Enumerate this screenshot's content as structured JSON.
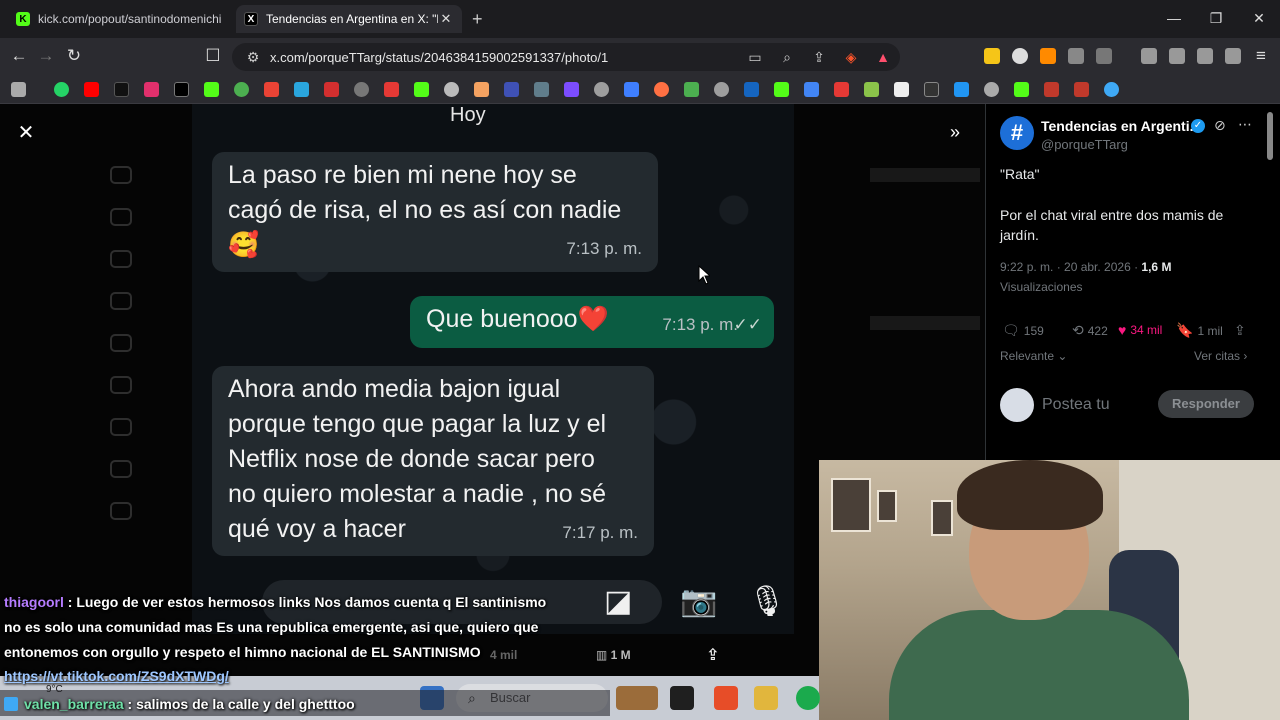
{
  "browser": {
    "tabs": [
      {
        "title": "kick.com/popout/santinodomenichi",
        "active": false
      },
      {
        "title": "Tendencias en Argentina en X: \"R",
        "active": true
      }
    ],
    "url": "x.com/porqueTTarg/status/2046384159002591337/photo/1"
  },
  "chat_photo": {
    "day_label": "Hoy",
    "messages": [
      {
        "direction": "in",
        "text_lines": [
          "La paso re bien mi nene hoy se",
          "cagó de risa, el no es así con nadie",
          "🥰"
        ],
        "time": "7:13 p. m."
      },
      {
        "direction": "out",
        "text": "Que buenooo❤️",
        "time": "7:13 p. m.",
        "ticks": "✓✓"
      },
      {
        "direction": "in",
        "text_lines": [
          "Ahora ando media bajon igual",
          "porque tengo que pagar la luz y el",
          "Netflix nose de donde sacar pero",
          "no quiero molestar a nadie , no sé",
          "qué voy a hacer"
        ],
        "time": "7:17 p. m."
      }
    ]
  },
  "tweet": {
    "author": "Tendencias en Argenti...",
    "handle": "@porqueTTarg",
    "avatar_glyph": "#",
    "text_1": "\"Rata\"",
    "text_2": "Por el chat viral entre dos mamis de jardín.",
    "timestamp": "9:22 p. m. · 20 abr. 2026 · ",
    "views_count": "1,6 M",
    "views_label": "Visualizaciones",
    "replies": "159",
    "reposts": "422",
    "likes": "34 mil",
    "bookmarks": "1 mil",
    "sort_label": "Relevante",
    "quotes_label": "Ver citas",
    "reply_placeholder": "Postea tu",
    "reply_button": "Responder"
  },
  "stream_chat": [
    {
      "user": "thiagoorl",
      "lines": [
        " : Luego de ver estos hermosos links Nos damos cuenta q El santinismo",
        "no es solo una comunidad mas Es una republica emergente, asi que, quiero que",
        "entonemos con orgullo y respeto el himno nacional de EL SANTINISMO"
      ],
      "link": "https://vt.tiktok.com/ZS9dXTWDg/"
    },
    {
      "user": "valen_barreraa",
      "text": " : salimos de la calle y del ghetttoo"
    }
  ],
  "ghost_stats": {
    "views": "1 M",
    "likes": "4 mil"
  },
  "taskbar": {
    "search_placeholder": "Buscar",
    "weather": "9°C"
  },
  "colors": {
    "accent_blue": "#1d9bf0",
    "whatsapp_out": "#0b5c42",
    "like_pink": "#f91880",
    "bookmark_blue": "#1d9bf0"
  }
}
